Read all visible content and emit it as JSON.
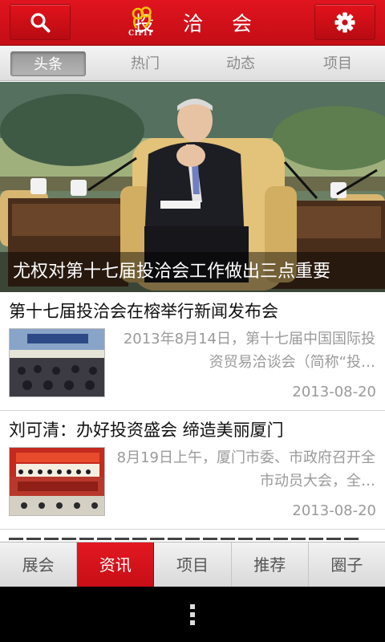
{
  "header": {
    "logo_subtitle": "CIFIT",
    "title": "投 洽 会",
    "search_icon": "search-icon",
    "settings_icon": "gear-icon",
    "brand_color": "#d3121b"
  },
  "segment_tabs": [
    "头条",
    "热门",
    "动态",
    "项目"
  ],
  "hero": {
    "caption": "尤权对第十七届投洽会工作做出三点重要"
  },
  "news": [
    {
      "title": "第十七届投洽会在榕举行新闻发布会",
      "summary": "2013年8月14日，第十七届中国国际投资贸易洽谈会（简称“投…",
      "date": "2013-08-20"
    },
    {
      "title": "刘可清：办好投资盛会 缔造美丽厦门",
      "summary": "8月19日上午，厦门市委、市政府召开全市动员大会，全…",
      "date": "2013-08-20"
    }
  ],
  "bottom_nav": [
    "展会",
    "资讯",
    "项目",
    "推荐",
    "圈子"
  ],
  "system": {
    "menu_icon": "overflow-menu-icon"
  }
}
